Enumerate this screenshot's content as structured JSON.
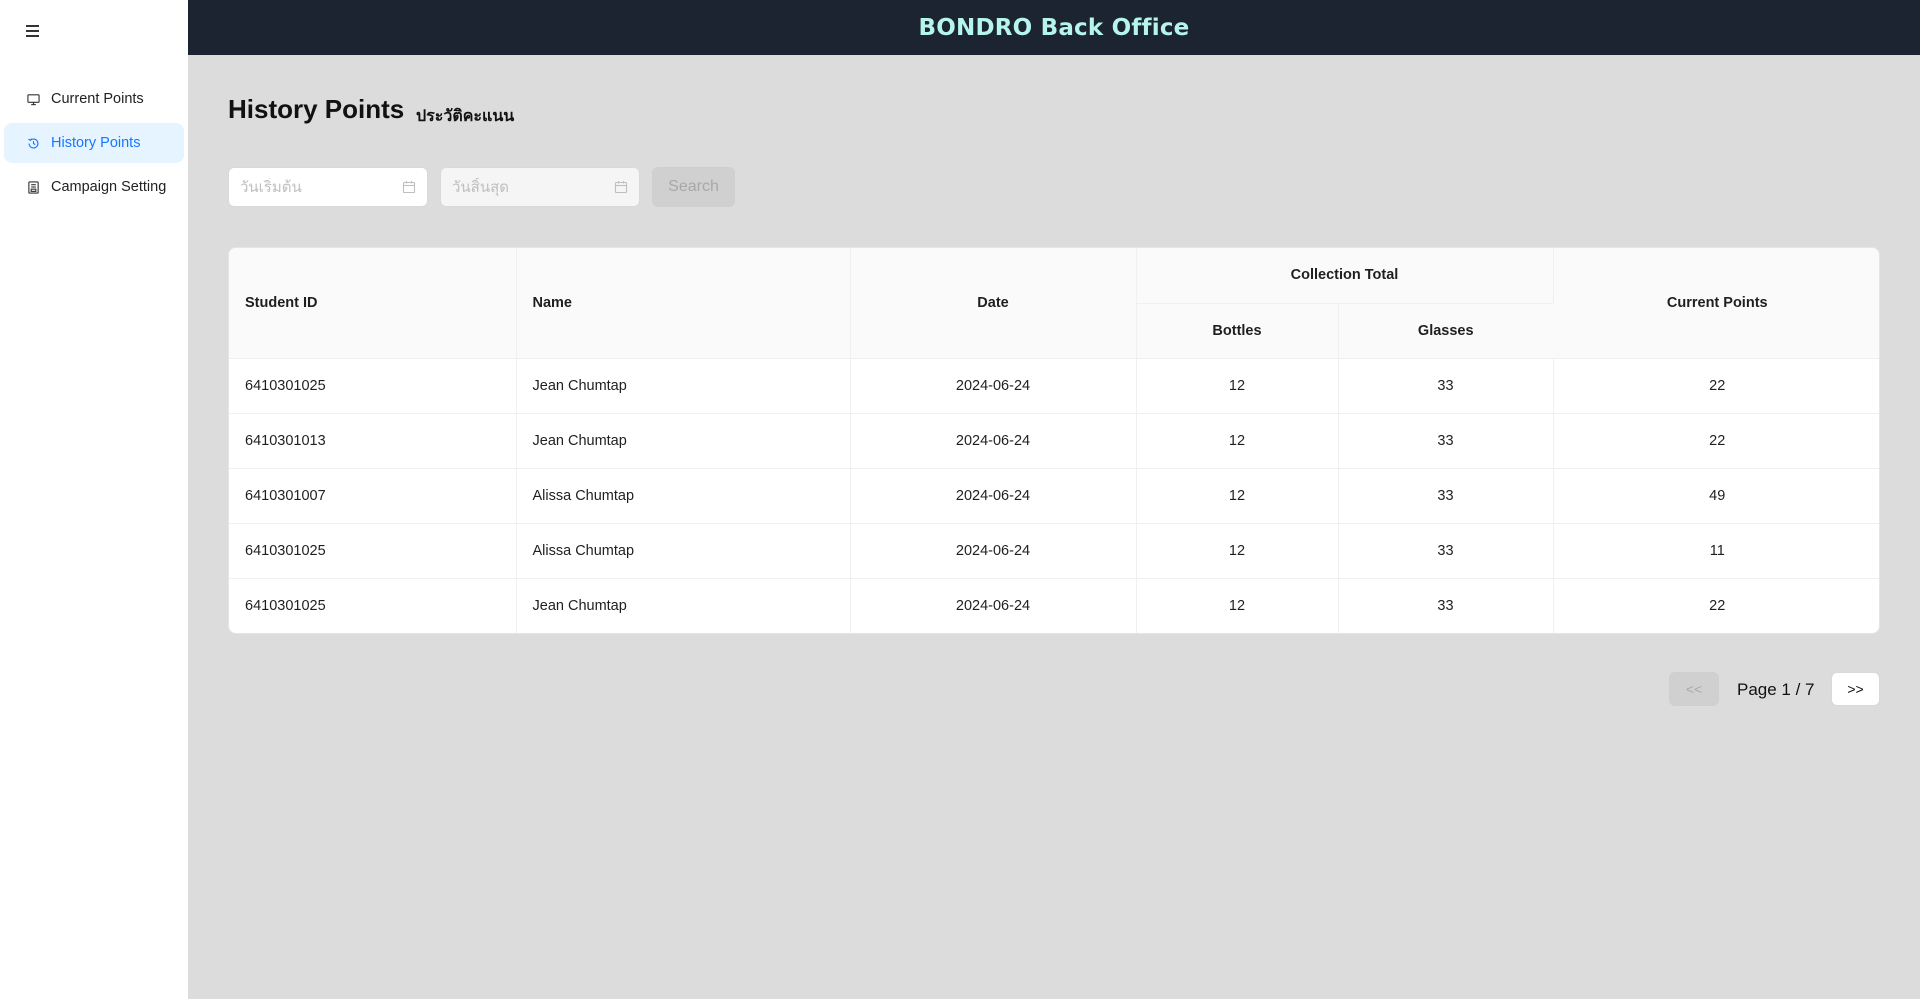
{
  "header": {
    "title": "BONDRO Back Office"
  },
  "sidebar": {
    "items": [
      {
        "label": "Current Points",
        "icon": "desktop-icon",
        "active": false
      },
      {
        "label": "History Points",
        "icon": "history-icon",
        "active": true
      },
      {
        "label": "Campaign Setting",
        "icon": "document-icon",
        "active": false
      }
    ]
  },
  "page": {
    "title": "History Points",
    "subtitle": "ประวัติคะแนน"
  },
  "filters": {
    "start_placeholder": "วันเริ่มต้น",
    "end_placeholder": "วันสิ้นสุด",
    "search_label": "Search"
  },
  "table": {
    "headers": {
      "student_id": "Student ID",
      "name": "Name",
      "date": "Date",
      "collection_total": "Collection Total",
      "bottles": "Bottles",
      "glasses": "Glasses",
      "current_points": "Current Points"
    },
    "rows": [
      {
        "student_id": "6410301025",
        "name": "Jean Chumtap",
        "date": "2024-06-24",
        "bottles": "12",
        "glasses": "33",
        "current_points": "22"
      },
      {
        "student_id": "6410301013",
        "name": "Jean Chumtap",
        "date": "2024-06-24",
        "bottles": "12",
        "glasses": "33",
        "current_points": "22"
      },
      {
        "student_id": "6410301007",
        "name": "Alissa Chumtap",
        "date": "2024-06-24",
        "bottles": "12",
        "glasses": "33",
        "current_points": "49"
      },
      {
        "student_id": "6410301025",
        "name": "Alissa Chumtap",
        "date": "2024-06-24",
        "bottles": "12",
        "glasses": "33",
        "current_points": "11"
      },
      {
        "student_id": "6410301025",
        "name": "Jean Chumtap",
        "date": "2024-06-24",
        "bottles": "12",
        "glasses": "33",
        "current_points": "22"
      }
    ]
  },
  "pagination": {
    "prev_label": "<<",
    "page_label": "Page 1 / 7",
    "next_label": ">>"
  },
  "colors": {
    "header_bg": "#1c2431",
    "header_title": "#b5f5ec",
    "active_nav_bg": "#e6f4ff",
    "active_nav_text": "#1677ff",
    "page_bg": "#dcdcdc"
  }
}
